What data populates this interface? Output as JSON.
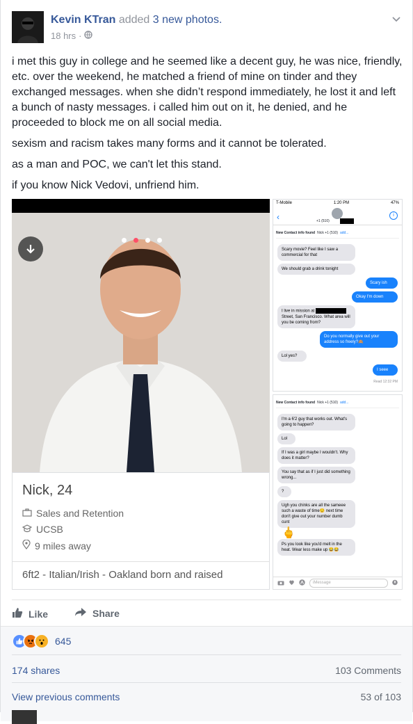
{
  "post": {
    "author": "Kevin KTran",
    "action_text": "added",
    "action_link": "3 new photos.",
    "timestamp": "18 hrs",
    "privacy_icon": "globe-icon",
    "menu_icon": "chevron-down-icon",
    "paragraphs": [
      "i met this guy in college and he seemed like a decent guy, he was nice, friendly, etc. over the weekend, he matched a friend of mine on tinder and they exchanged messages. when she didn’t respond immediately, he lost it and left a bunch of nasty messages. i called him out on it, he denied, and he proceeded to block me on all social media.",
      "sexism and racism takes many forms and it cannot be tolerated.",
      "as a man and POC, we can't let this stand.",
      "if you know Nick Vedovi, unfriend him."
    ]
  },
  "tinder_card": {
    "name": "Nick, 24",
    "job": "Sales and Retention",
    "school": "UCSB",
    "distance": "9 miles away",
    "bio": "6ft2 - Italian/Irish - Oakland born and raised"
  },
  "chat1": {
    "carrier": "T-Mobile",
    "time": "1:20 PM",
    "battery": "47%",
    "number_prefix": "+1 (510)",
    "contact_label": "New Contact info found",
    "contact_sub": "Nick +1 (510)",
    "add_label": "add...",
    "messages": [
      {
        "dir": "in",
        "text": "Scary movie? Feel like I saw a commercial for that"
      },
      {
        "dir": "in",
        "text": "We should grab a drink tonight"
      },
      {
        "dir": "out",
        "text": "Scary ish"
      },
      {
        "dir": "out",
        "text": "Okay I'm down"
      },
      {
        "dir": "in",
        "text": "I live in mission at [redacted] Street, San Francisco. What area will you be coming from?"
      },
      {
        "dir": "out",
        "text": "Do you normally give out your address so freely?🙈"
      },
      {
        "dir": "in",
        "text": "Lol yes?"
      },
      {
        "dir": "out",
        "text": "I seee"
      }
    ],
    "read_receipt": "Read 12:32 PM"
  },
  "chat2": {
    "contact_label": "New Contact info found",
    "contact_sub": "Nick +1 (510)",
    "add_label": "add...",
    "messages": [
      {
        "dir": "in",
        "text": "I'm a 6'2 guy that works out. What's going to happen?"
      },
      {
        "dir": "in",
        "text": "Lol"
      },
      {
        "dir": "in",
        "text": "If I was a girl maybe I wouldn't. Why does it matter?"
      },
      {
        "dir": "in",
        "text": "You say that as if I just did something wrong..."
      },
      {
        "dir": "in",
        "text": "?"
      },
      {
        "dir": "in",
        "text": "Ugh you chinks are all the sameee such a waste of time😒 next time don't give out your number dumb cunt"
      },
      {
        "dir": "in",
        "text": "🖕"
      },
      {
        "dir": "in",
        "text": "Ps you look like you'd melt in the heat. Wear less make up 😂😂"
      }
    ],
    "input_placeholder": "iMessage"
  },
  "actions": {
    "like": "Like",
    "share": "Share"
  },
  "reactions": {
    "count": "645",
    "types": [
      "like",
      "angry",
      "wow"
    ]
  },
  "engagement": {
    "shares": "174 shares",
    "comments": "103 Comments",
    "view_previous": "View previous comments",
    "page": "53 of 103"
  },
  "colors": {
    "link": "#365899",
    "imessage_blue": "#1982fc",
    "tinder_dot": "#fd5068"
  }
}
